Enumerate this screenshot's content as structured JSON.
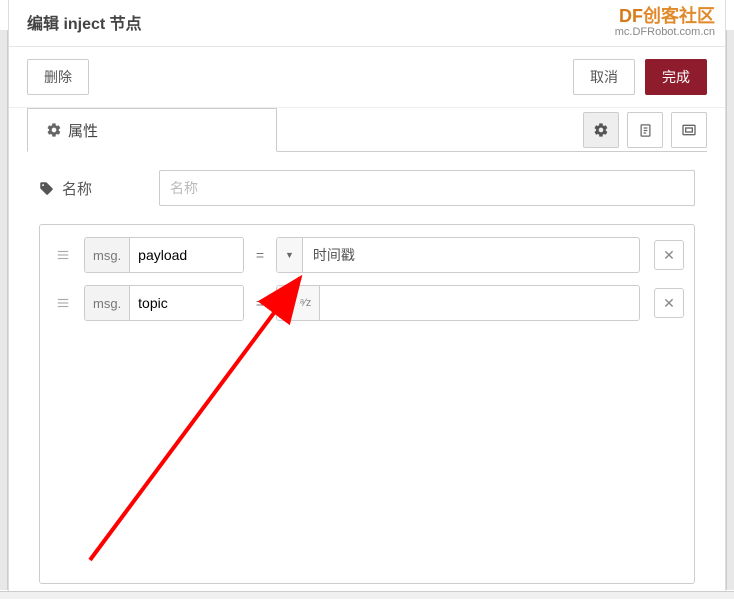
{
  "watermark": {
    "line1_prefix": "DF",
    "line1_rest": "创客社区",
    "line2": "mc.DFRobot.com.cn"
  },
  "header": {
    "title": "编辑 inject 节点"
  },
  "actions": {
    "delete": "删除",
    "cancel": "取消",
    "done": "完成"
  },
  "tabs": {
    "properties": "属性"
  },
  "form": {
    "name_label": "名称",
    "name_placeholder": "名称",
    "name_value": ""
  },
  "rows": [
    {
      "prop_prefix": "msg.",
      "prop_value": "payload",
      "eq": "=",
      "val_type_label": "时间戳",
      "val_value": ""
    },
    {
      "prop_prefix": "msg.",
      "prop_value": "topic",
      "eq": "=",
      "val_type_label": "ᵃ⁄z",
      "val_value": ""
    }
  ]
}
